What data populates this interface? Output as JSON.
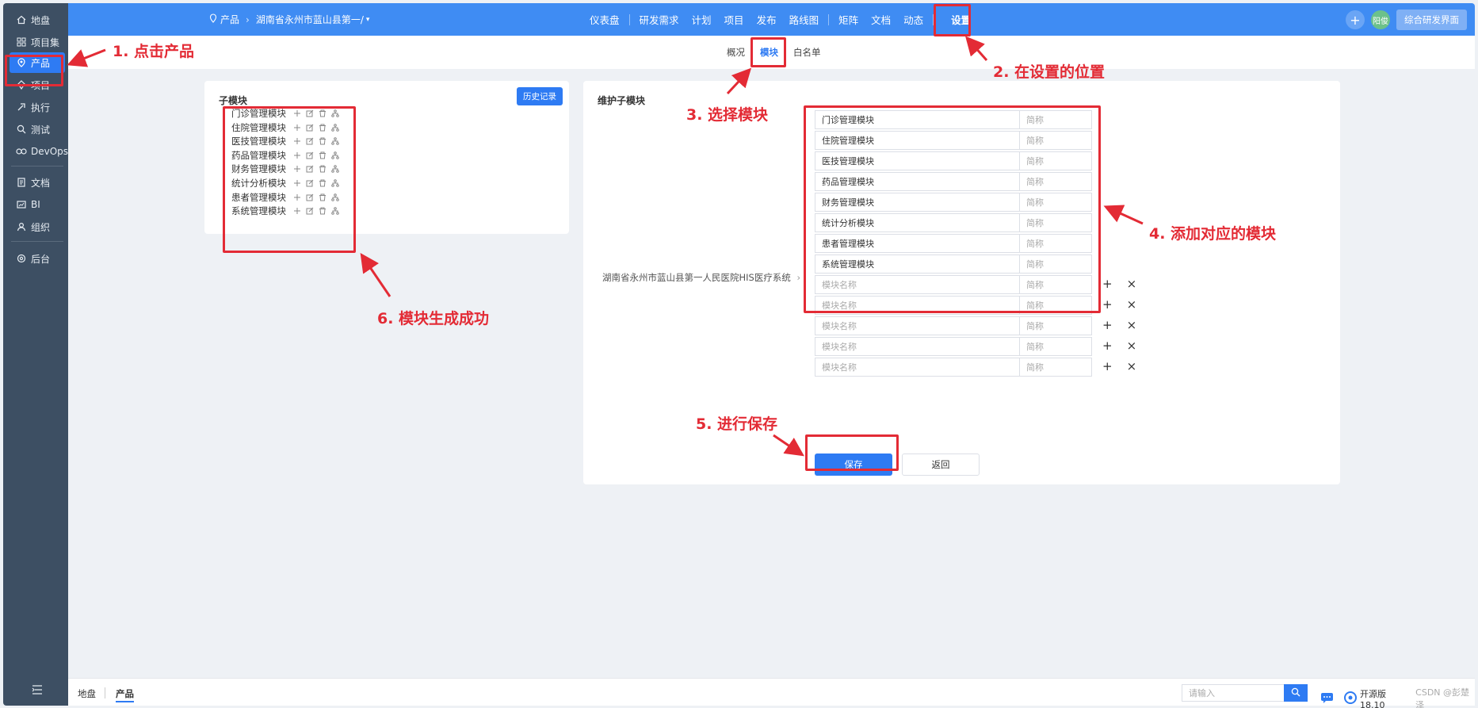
{
  "sidebar": {
    "items": [
      {
        "label": "地盘",
        "icon": "home-icon"
      },
      {
        "label": "项目集",
        "icon": "grid-icon"
      },
      {
        "label": "产品",
        "icon": "product-icon",
        "active": true
      },
      {
        "label": "项目",
        "icon": "project-icon"
      },
      {
        "label": "执行",
        "icon": "execute-icon"
      },
      {
        "label": "测试",
        "icon": "test-icon"
      },
      {
        "label": "DevOps",
        "icon": "devops-icon"
      },
      {
        "label": "文档",
        "icon": "doc-icon"
      },
      {
        "label": "BI",
        "icon": "bi-icon"
      },
      {
        "label": "组织",
        "icon": "org-icon"
      },
      {
        "label": "后台",
        "icon": "gear-icon"
      }
    ]
  },
  "header": {
    "breadcrumb_root": "产品",
    "breadcrumb_product": "湖南省永州市蓝山县第一/",
    "nav": [
      "仪表盘",
      "研发需求",
      "计划",
      "项目",
      "发布",
      "路线图",
      "矩阵",
      "文档",
      "动态",
      "设置"
    ],
    "active_nav": "设置",
    "user_avatar": "阳俊",
    "switch_btn": "综合研发界面"
  },
  "subtabs": [
    "概况",
    "模块",
    "白名单"
  ],
  "active_subtab": "模块",
  "left_panel": {
    "title": "子模块",
    "history_btn": "历史记录",
    "modules": [
      "门诊管理模块",
      "住院管理模块",
      "医技管理模块",
      "药品管理模块",
      "财务管理模块",
      "统计分析模块",
      "患者管理模块",
      "系统管理模块"
    ]
  },
  "right_panel": {
    "title": "维护子模块",
    "product_path": "湖南省永州市蓝山县第一人民医院HIS医疗系统",
    "filled_rows": [
      "门诊管理模块",
      "住院管理模块",
      "医技管理模块",
      "药品管理模块",
      "财务管理模块",
      "统计分析模块",
      "患者管理模块",
      "系统管理模块"
    ],
    "name_placeholder": "模块名称",
    "short_placeholder": "简称",
    "empty_row_count": 5,
    "save_btn": "保存",
    "back_btn": "返回"
  },
  "annotations": {
    "a1": "1. 点击产品",
    "a2": "2. 在设置的位置",
    "a3": "3. 选择模块",
    "a4": "4. 添加对应的模块",
    "a5": "5. 进行保存",
    "a6": "6. 模块生成成功",
    "color": "#e32b35"
  },
  "footer": {
    "tabs": [
      "地盘",
      "产品"
    ],
    "active_tab": "产品",
    "search_placeholder": "请输入",
    "version": "开源版18.10",
    "watermark": "CSDN @彭楚泽"
  },
  "colors": {
    "primary": "#2e7bf3",
    "topbar": "#3f8cf3",
    "sidebar": "#3d4f63"
  }
}
